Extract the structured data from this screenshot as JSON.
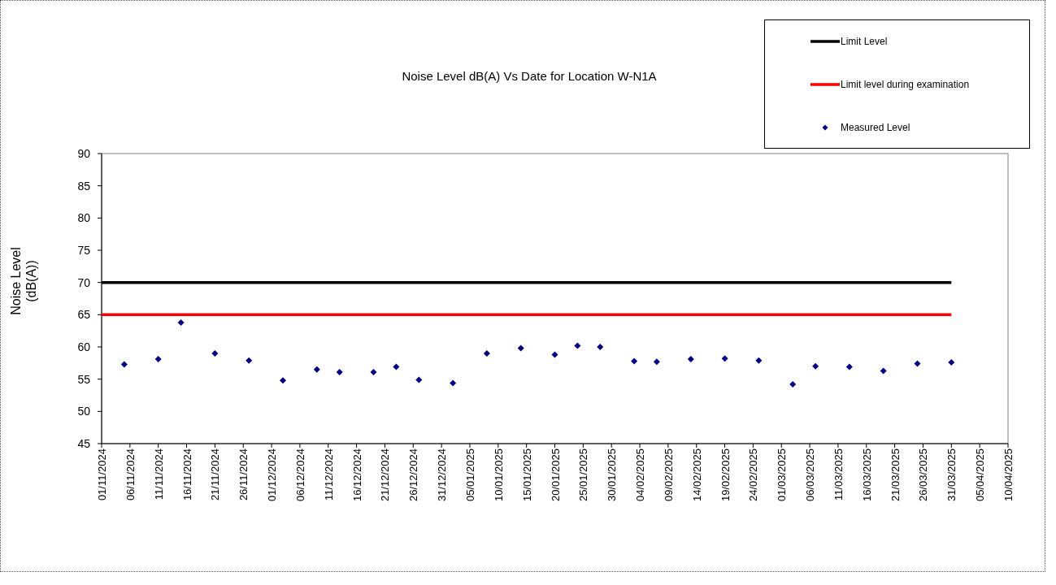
{
  "chart": {
    "chart_data": {
      "type": "scatter",
      "title": "Noise Level dB(A) Vs Date for Location W-N1A",
      "ylabel": "Noise Level\n(dB(A))",
      "categories": [
        "01/11/2024",
        null,
        null,
        null,
        null,
        "06/11/2024",
        null,
        null,
        null,
        null,
        "11/11/2024",
        null,
        null,
        null,
        null,
        "16/11/2024",
        null,
        null,
        null,
        null,
        "21/11/2024",
        null,
        null,
        null,
        null,
        "26/11/2024",
        null,
        null,
        null,
        null,
        "01/12/2024",
        null,
        null,
        null,
        null,
        "06/12/2024",
        null,
        null,
        null,
        null,
        "11/12/2024",
        null,
        null,
        null,
        null,
        "16/12/2024",
        null,
        null,
        null,
        null,
        "21/12/2024",
        null,
        null,
        null,
        null,
        "26/12/2024",
        null,
        null,
        null,
        null,
        "31/12/2024",
        null,
        null,
        null,
        null,
        "05/01/2025",
        null,
        null,
        null,
        null,
        "10/01/2025",
        null,
        null,
        null,
        null,
        "15/01/2025",
        null,
        null,
        null,
        null,
        "20/01/2025",
        null,
        null,
        null,
        null,
        "25/01/2025",
        null,
        null,
        null,
        null,
        "30/01/2025",
        null,
        null,
        null,
        null,
        "04/02/2025",
        null,
        null,
        null,
        null,
        "09/02/2025",
        null,
        null,
        null,
        null,
        "14/02/2025",
        null,
        null,
        null,
        null,
        "19/02/2025",
        null,
        null,
        null,
        null,
        "24/02/2025",
        null,
        null,
        null,
        null,
        "01/03/2025",
        null,
        null,
        null,
        null,
        "06/03/2025",
        null,
        null,
        null,
        null,
        "11/03/2025",
        null,
        null,
        null,
        null,
        "16/03/2025",
        null,
        null,
        null,
        null,
        "21/03/2025",
        null,
        null,
        null,
        null,
        "26/03/2025",
        null,
        null,
        null,
        null,
        "31/03/2025",
        null,
        null,
        null,
        null,
        "05/04/2025",
        null,
        null,
        null,
        null,
        "10/04/2025"
      ],
      "series": [
        {
          "name": "Limit Level",
          "type": "line",
          "color": "#000000",
          "values": [
            70,
            70,
            70,
            70,
            70,
            70,
            70,
            70,
            70,
            70,
            70,
            70,
            70,
            70,
            70,
            70,
            70,
            70,
            70,
            70,
            70,
            70,
            70,
            70,
            70,
            70,
            70,
            70,
            70,
            70,
            70,
            70,
            70,
            70,
            70,
            70,
            70,
            70,
            70,
            70,
            70,
            70,
            70,
            70,
            70,
            70,
            70,
            70,
            70,
            70,
            70,
            70,
            70,
            70,
            70,
            70,
            70,
            70,
            70,
            70,
            70,
            70,
            70,
            70,
            70,
            70,
            70,
            70,
            70,
            70,
            70,
            70,
            70,
            70,
            70,
            70,
            70,
            70,
            70,
            70,
            70,
            70,
            70,
            70,
            70,
            70,
            70,
            70,
            70,
            70,
            70,
            70,
            70,
            70,
            70,
            70,
            70,
            70,
            70,
            70,
            70,
            70,
            70,
            70,
            70,
            70,
            70,
            70,
            70,
            70,
            70,
            70,
            70,
            70,
            70,
            70,
            70,
            70,
            70,
            70,
            70,
            70,
            70,
            70,
            70,
            70,
            70,
            70,
            70,
            70,
            70,
            70,
            70,
            70,
            70,
            70,
            70,
            70,
            70,
            70,
            70,
            70,
            70,
            70,
            70,
            70,
            70,
            70,
            70,
            70,
            70,
            null,
            null,
            null,
            null,
            null,
            null,
            null,
            null,
            null,
            null
          ]
        },
        {
          "name": "Limit level during examination",
          "type": "line",
          "color": "#ff0000",
          "values": [
            65,
            65,
            65,
            65,
            65,
            65,
            65,
            65,
            65,
            65,
            65,
            65,
            65,
            65,
            65,
            65,
            65,
            65,
            65,
            65,
            65,
            65,
            65,
            65,
            65,
            65,
            65,
            65,
            65,
            65,
            65,
            65,
            65,
            65,
            65,
            65,
            65,
            65,
            65,
            65,
            65,
            65,
            65,
            65,
            65,
            65,
            65,
            65,
            65,
            65,
            65,
            65,
            65,
            65,
            65,
            65,
            65,
            65,
            65,
            65,
            65,
            65,
            65,
            65,
            65,
            65,
            65,
            65,
            65,
            65,
            65,
            65,
            65,
            65,
            65,
            65,
            65,
            65,
            65,
            65,
            65,
            65,
            65,
            65,
            65,
            65,
            65,
            65,
            65,
            65,
            65,
            65,
            65,
            65,
            65,
            65,
            65,
            65,
            65,
            65,
            65,
            65,
            65,
            65,
            65,
            65,
            65,
            65,
            65,
            65,
            65,
            65,
            65,
            65,
            65,
            65,
            65,
            65,
            65,
            65,
            65,
            65,
            65,
            65,
            65,
            65,
            65,
            65,
            65,
            65,
            65,
            65,
            65,
            65,
            65,
            65,
            65,
            65,
            65,
            65,
            65,
            65,
            65,
            65,
            65,
            65,
            65,
            65,
            65,
            65,
            65,
            null,
            null,
            null,
            null,
            null,
            null,
            null,
            null,
            null,
            null
          ]
        },
        {
          "name": "Measured Level",
          "type": "scatter",
          "color": "#000080",
          "values": [
            null,
            null,
            null,
            null,
            57.3,
            null,
            null,
            null,
            null,
            null,
            58.1,
            null,
            null,
            null,
            63.8,
            null,
            null,
            null,
            null,
            null,
            59.0,
            null,
            null,
            null,
            null,
            null,
            57.9,
            null,
            null,
            null,
            null,
            null,
            54.8,
            null,
            null,
            null,
            null,
            null,
            56.5,
            null,
            null,
            null,
            56.1,
            null,
            null,
            null,
            null,
            null,
            56.1,
            null,
            null,
            null,
            56.9,
            null,
            null,
            null,
            54.9,
            null,
            null,
            null,
            null,
            null,
            54.4,
            null,
            null,
            null,
            null,
            null,
            59.0,
            null,
            null,
            null,
            null,
            null,
            59.8,
            null,
            null,
            null,
            null,
            null,
            58.8,
            null,
            null,
            null,
            60.2,
            null,
            null,
            null,
            60.0,
            null,
            null,
            null,
            null,
            null,
            57.8,
            null,
            null,
            null,
            57.7,
            null,
            null,
            null,
            null,
            null,
            58.1,
            null,
            null,
            null,
            null,
            null,
            58.2,
            null,
            null,
            null,
            null,
            null,
            57.9,
            null,
            null,
            null,
            null,
            null,
            54.2,
            null,
            null,
            null,
            57.0,
            null,
            null,
            null,
            null,
            null,
            56.9,
            null,
            null,
            null,
            null,
            null,
            56.3,
            null,
            null,
            null,
            null,
            null,
            57.4,
            null,
            null,
            null,
            null,
            null,
            57.6,
            null,
            null,
            null,
            null,
            null,
            null,
            null,
            null,
            null,
            null
          ]
        }
      ],
      "legend": "upper right",
      "ylim": [
        45,
        90
      ],
      "yticks": [
        45,
        50,
        55,
        60,
        65,
        70,
        75,
        80,
        85,
        90
      ]
    }
  }
}
